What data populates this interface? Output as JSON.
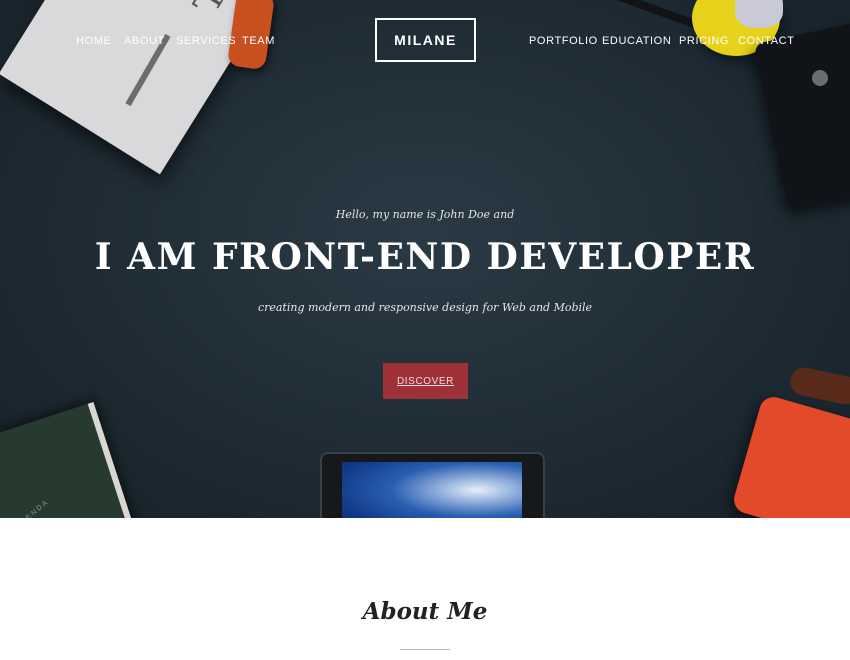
{
  "nav": {
    "left_items": [
      "HOME",
      "ABOUT",
      "SERVICES",
      "TEAM"
    ],
    "right_items": [
      "PORTFOLIO",
      "EDUCATION",
      "PRICING",
      "CONTACT"
    ],
    "logo": "MILANE"
  },
  "hero": {
    "intro": "Hello, my name is John Doe and",
    "title": "I AM FRONT-END DEVELOPER",
    "subtitle": "creating modern and responsive design for Web and Mobile",
    "button_label": "DISCOVER"
  },
  "about": {
    "title": "About Me"
  },
  "colors": {
    "hero_bg": "#1f2c35",
    "button_bg": "#9e3138",
    "text_light": "#ffffff"
  }
}
